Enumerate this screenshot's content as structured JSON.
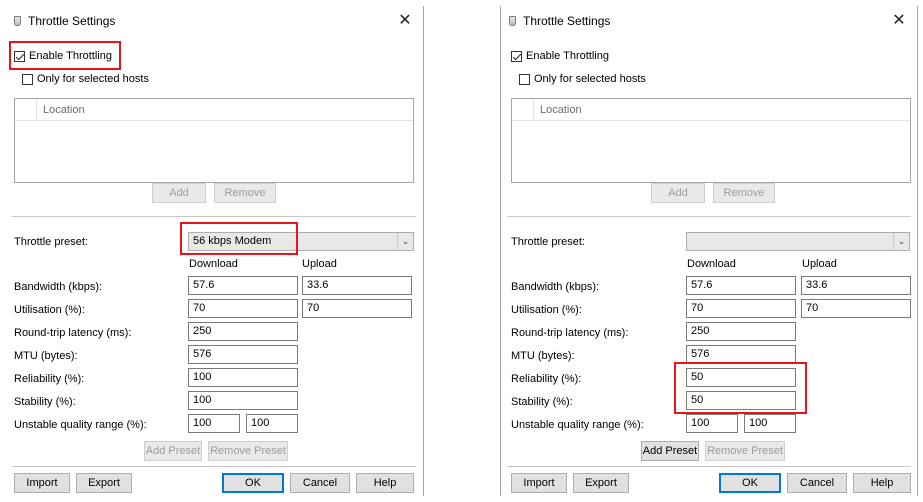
{
  "left_dialog": {
    "title": "Throttle Settings",
    "close_glyph": "✕",
    "enable_throttling_label": "Enable Throttling",
    "enable_throttling_checked": true,
    "only_selected_hosts_label": "Only for selected hosts",
    "only_selected_hosts_checked": false,
    "location_column_header": "Location",
    "add_label": "Add",
    "remove_label": "Remove",
    "throttle_preset_label": "Throttle preset:",
    "throttle_preset_value": "56 kbps Modem",
    "download_header": "Download",
    "upload_header": "Upload",
    "bandwidth_label": "Bandwidth (kbps):",
    "bandwidth_download": "57.6",
    "bandwidth_upload": "33.6",
    "utilisation_label": "Utilisation (%):",
    "utilisation_download": "70",
    "utilisation_upload": "70",
    "latency_label": "Round-trip latency (ms):",
    "latency_value": "250",
    "mtu_label": "MTU (bytes):",
    "mtu_value": "576",
    "reliability_label": "Reliability (%):",
    "reliability_value": "100",
    "stability_label": "Stability (%):",
    "stability_value": "100",
    "unstable_label": "Unstable quality range (%):",
    "unstable_min": "100",
    "unstable_max": "100",
    "add_preset_label": "Add Preset",
    "remove_preset_label": "Remove Preset",
    "import_label": "Import",
    "export_label": "Export",
    "ok_label": "OK",
    "cancel_label": "Cancel",
    "help_label": "Help"
  },
  "right_dialog": {
    "title": "Throttle Settings",
    "close_glyph": "✕",
    "enable_throttling_label": "Enable Throttling",
    "enable_throttling_checked": true,
    "only_selected_hosts_label": "Only for selected hosts",
    "only_selected_hosts_checked": false,
    "location_column_header": "Location",
    "add_label": "Add",
    "remove_label": "Remove",
    "throttle_preset_label": "Throttle preset:",
    "throttle_preset_value": "",
    "download_header": "Download",
    "upload_header": "Upload",
    "bandwidth_label": "Bandwidth (kbps):",
    "bandwidth_download": "57.6",
    "bandwidth_upload": "33.6",
    "utilisation_label": "Utilisation (%):",
    "utilisation_download": "70",
    "utilisation_upload": "70",
    "latency_label": "Round-trip latency (ms):",
    "latency_value": "250",
    "mtu_label": "MTU (bytes):",
    "mtu_value": "576",
    "reliability_label": "Reliability (%):",
    "reliability_value": "50",
    "stability_label": "Stability (%):",
    "stability_value": "50",
    "unstable_label": "Unstable quality range (%):",
    "unstable_min": "100",
    "unstable_max": "100",
    "add_preset_label": "Add Preset",
    "remove_preset_label": "Remove Preset",
    "import_label": "Import",
    "export_label": "Export",
    "ok_label": "OK",
    "cancel_label": "Cancel",
    "help_label": "Help"
  },
  "colors": {
    "highlight": "#e8141c",
    "focus_blue": "#0078d7"
  }
}
